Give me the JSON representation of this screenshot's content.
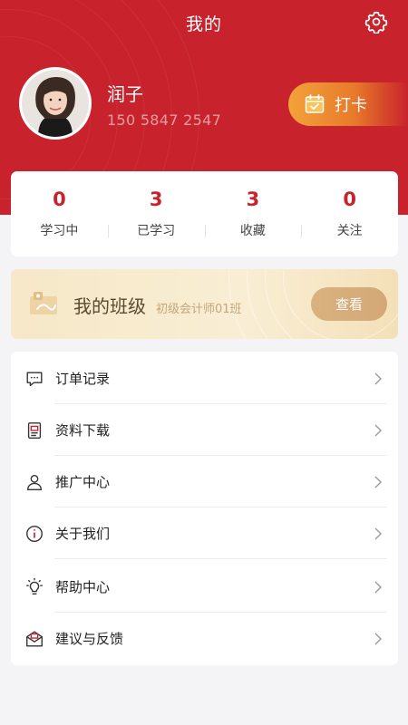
{
  "header": {
    "title": "我的",
    "settings_icon": "gear-icon"
  },
  "user": {
    "name": "润子",
    "phone": "150 5847 2547"
  },
  "checkin": {
    "label": "打卡",
    "icon": "calendar-check-icon"
  },
  "stats": [
    {
      "value": "0",
      "label": "学习中"
    },
    {
      "value": "3",
      "label": "已学习"
    },
    {
      "value": "3",
      "label": "收藏"
    },
    {
      "value": "0",
      "label": "关注"
    }
  ],
  "class_card": {
    "title": "我的班级",
    "subtitle": "初级会计师01班",
    "button": "查看"
  },
  "menu": [
    {
      "label": "订单记录",
      "icon": "chat-icon"
    },
    {
      "label": "资料下载",
      "icon": "document-icon"
    },
    {
      "label": "推广中心",
      "icon": "user-icon"
    },
    {
      "label": "关于我们",
      "icon": "info-icon"
    },
    {
      "label": "帮助中心",
      "icon": "lightbulb-icon"
    },
    {
      "label": "建议与反馈",
      "icon": "mail-icon"
    }
  ],
  "colors": {
    "primary": "#c8232c",
    "accent_gold": "#d9b27f",
    "checkin_orange": "#f3a23a"
  }
}
